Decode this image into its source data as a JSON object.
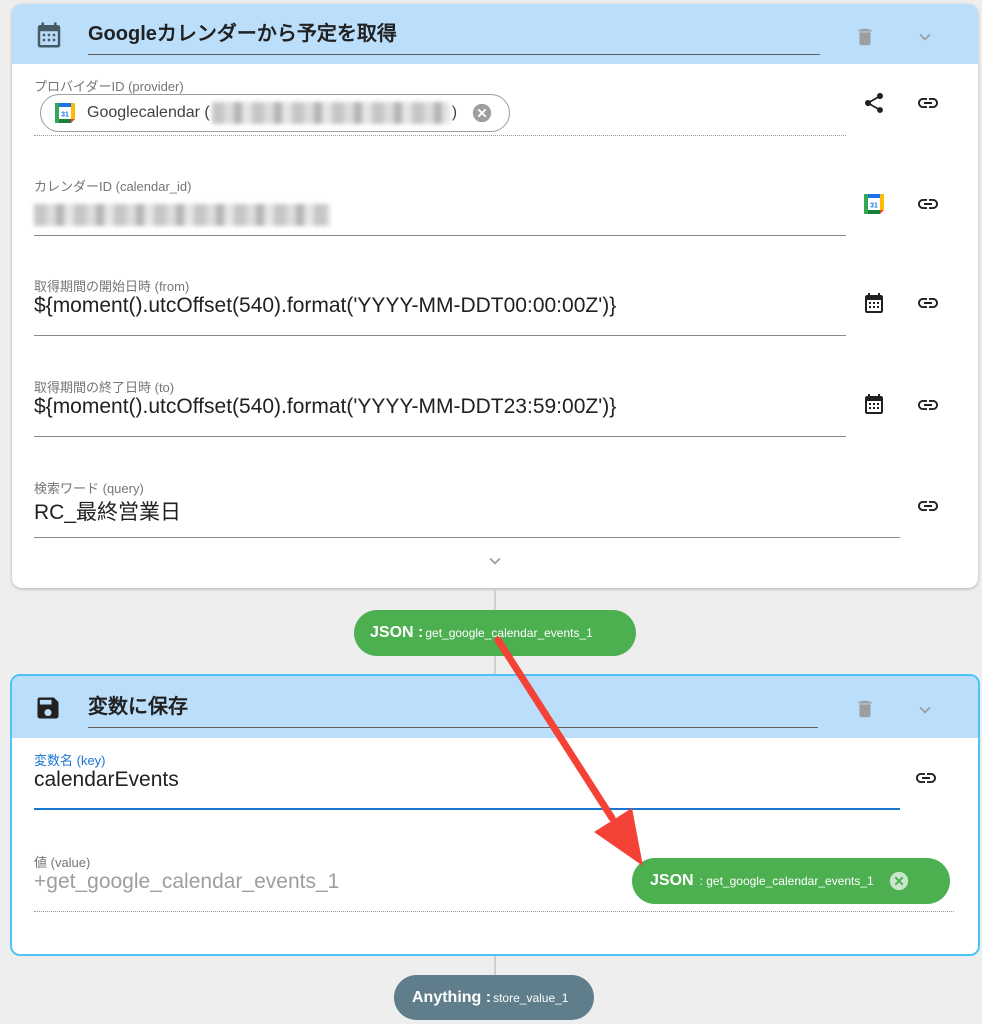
{
  "card1": {
    "title": "Googleカレンダーから予定を取得",
    "icon": "calendar-icon",
    "fields": {
      "provider": {
        "label": "プロバイダーID (provider)",
        "chip_text": "Googlecalendar (",
        "chip_suffix": ")"
      },
      "calendar_id": {
        "label": "カレンダーID (calendar_id)"
      },
      "from": {
        "label": "取得期間の開始日時 (from)",
        "value": "${moment().utcOffset(540).format('YYYY-MM-DDT00:00:00Z')}"
      },
      "to": {
        "label": "取得期間の終了日時 (to)",
        "value": "${moment().utcOffset(540).format('YYYY-MM-DDT23:59:00Z')}"
      },
      "query": {
        "label": "検索ワード (query)",
        "value": "RC_最終営業日"
      }
    },
    "output_chip": {
      "type": "JSON :",
      "name": "get_google_calendar_events_1",
      "color": "#4caf50"
    }
  },
  "card2": {
    "title": "変数に保存",
    "icon": "save-icon",
    "fields": {
      "key": {
        "label": "変数名 (key)",
        "value": "calendarEvents"
      },
      "value": {
        "label": "値 (value)",
        "placeholder": "+get_google_calendar_events_1"
      }
    },
    "value_chip": {
      "type": "JSON",
      "name": ": get_google_calendar_events_1",
      "color": "#4caf50"
    },
    "output_chip": {
      "type": "Anything :",
      "name": "store_value_1",
      "color": "#607d8b"
    }
  },
  "colors": {
    "header_bg": "#bbdefb",
    "active_border": "#4fc3f7",
    "arrow": "#f44336",
    "key_underline": "#1976d2"
  }
}
